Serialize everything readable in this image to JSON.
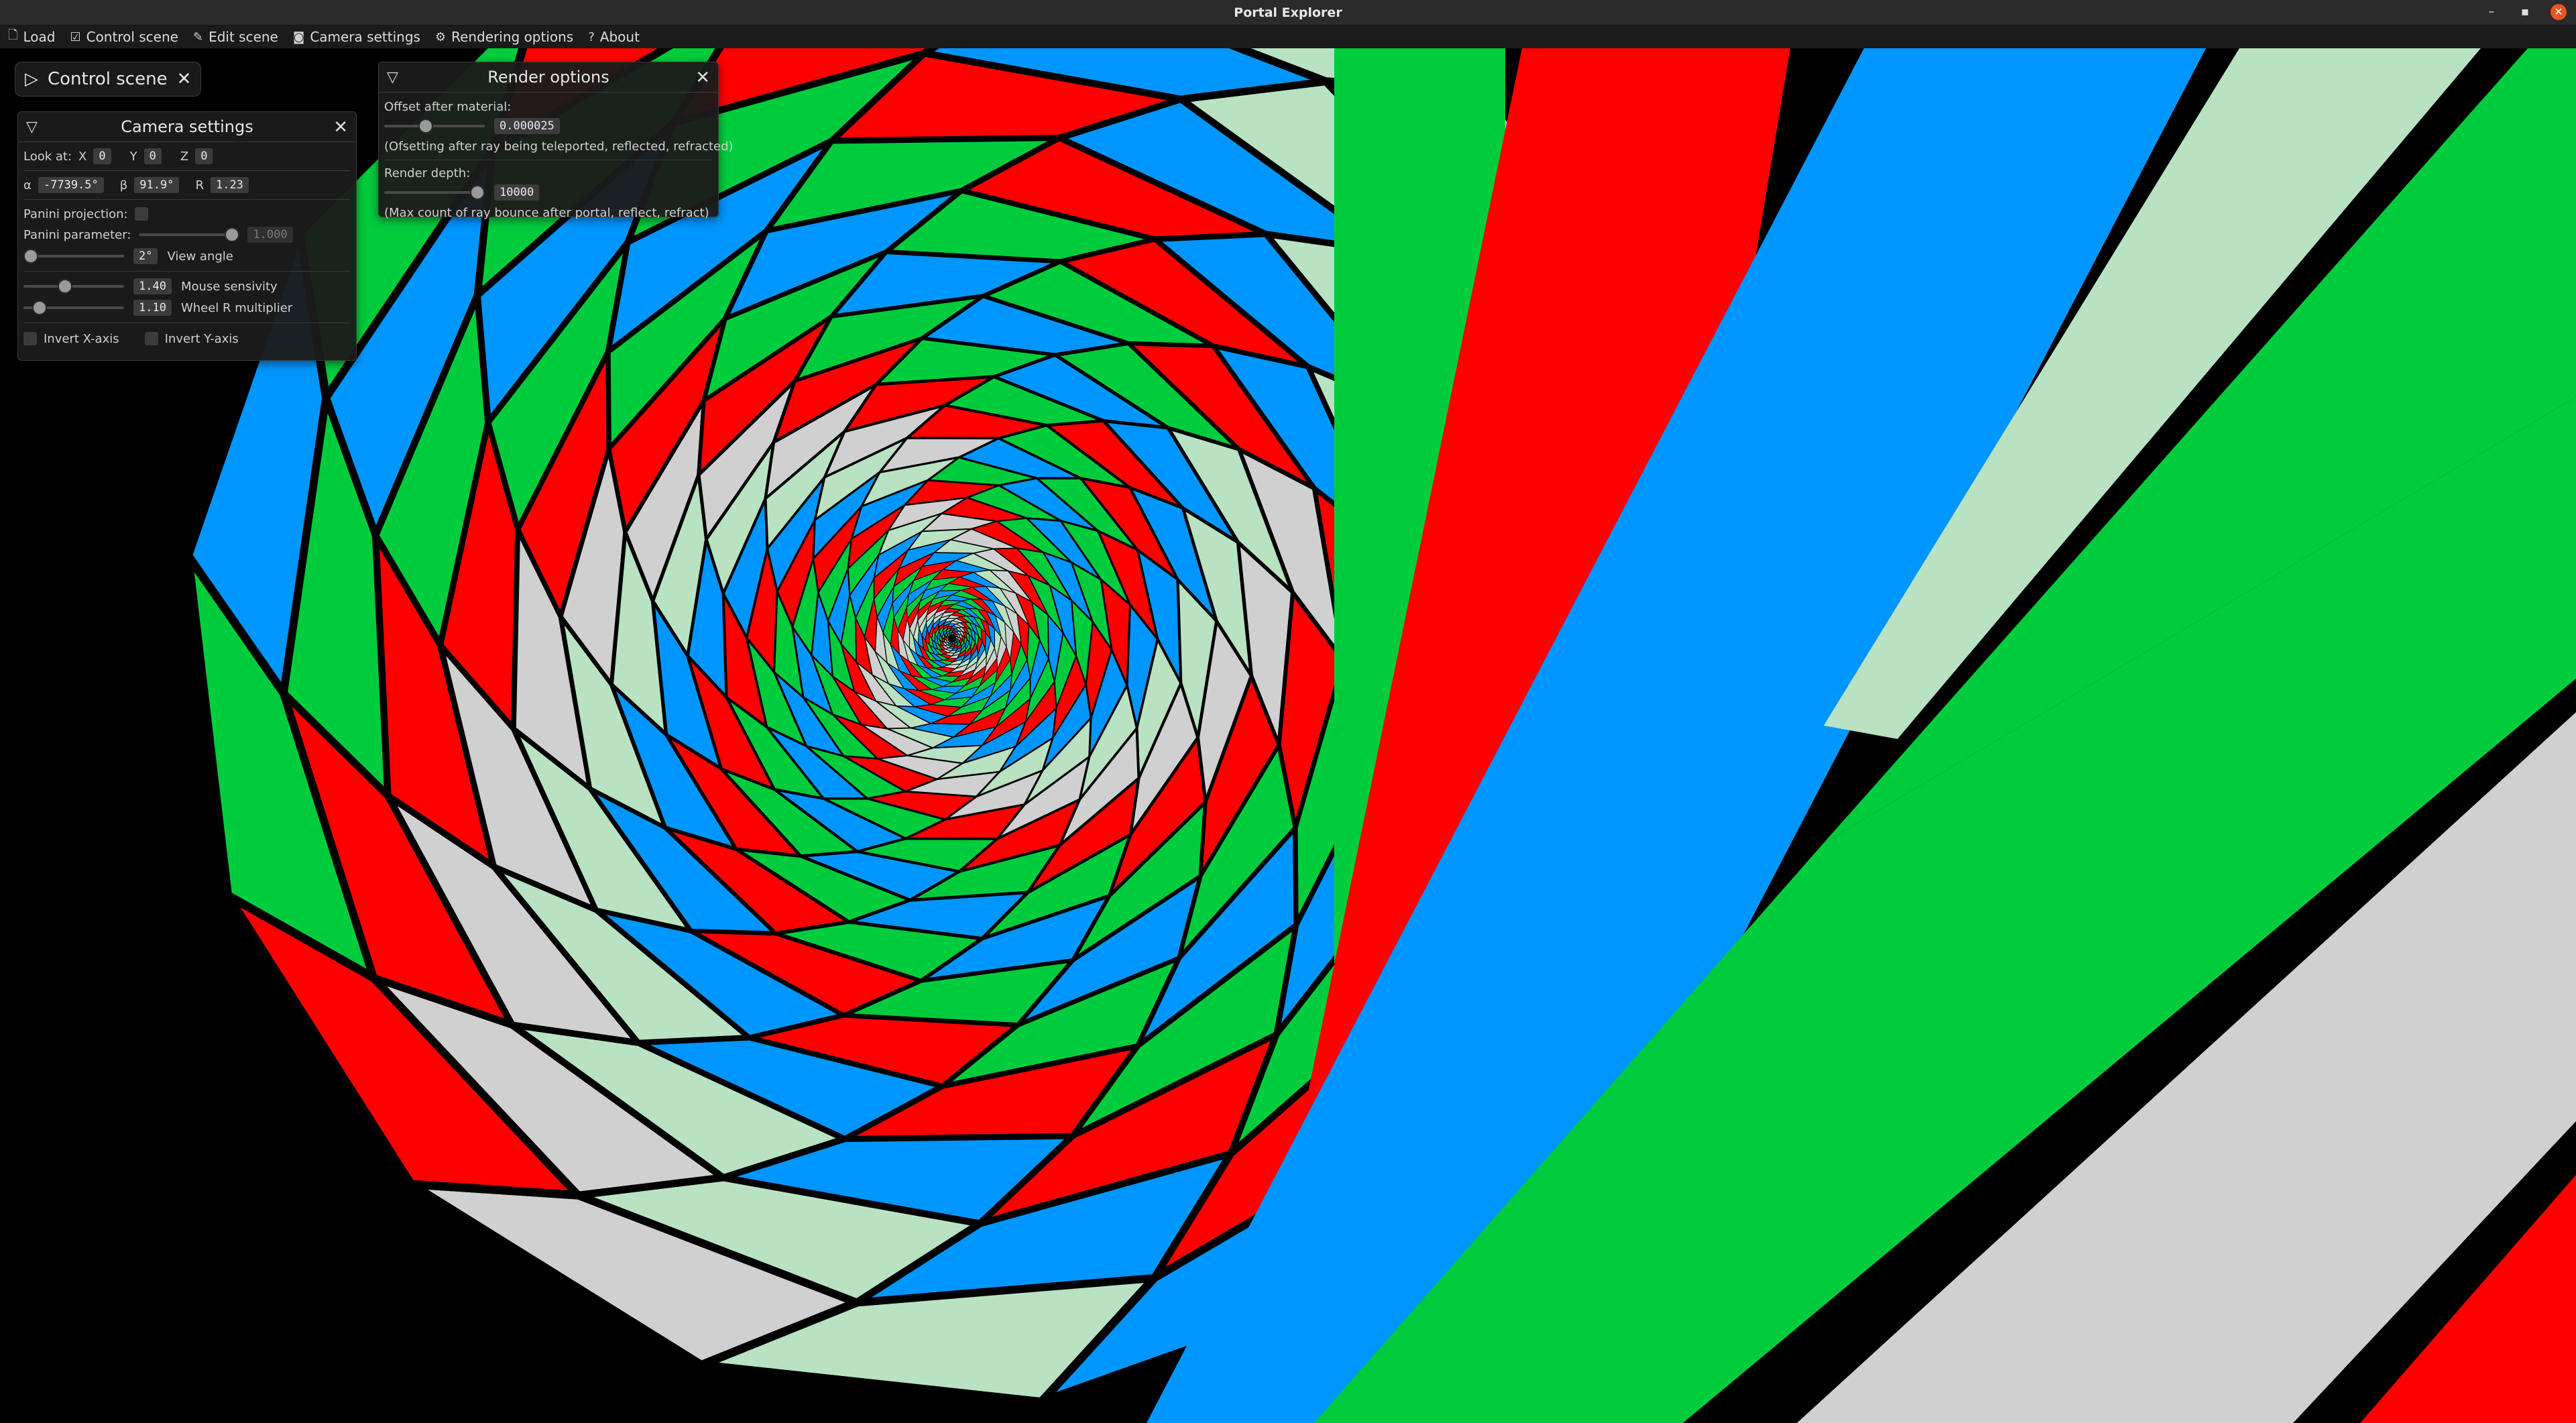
{
  "window": {
    "title": "Portal Explorer",
    "controls": [
      "minimize-icon",
      "maximize-icon",
      "close-icon"
    ]
  },
  "menu": [
    {
      "icon": "file-icon",
      "label": "Load"
    },
    {
      "icon": "checkbox-icon",
      "label": "Control scene"
    },
    {
      "icon": "pencil-icon",
      "label": "Edit scene"
    },
    {
      "icon": "camera-icon",
      "label": "Camera settings"
    },
    {
      "icon": "gear-icon",
      "label": "Rendering options"
    },
    {
      "icon": "question-icon",
      "label": "About"
    }
  ],
  "control_scene": {
    "title": "Control scene"
  },
  "camera": {
    "title": "Camera settings",
    "look_at_label": "Look at:",
    "x_label": "X",
    "x_value": "0",
    "y_label": "Y",
    "y_value": "0",
    "z_label": "Z",
    "z_value": "0",
    "alpha_label": "α",
    "alpha_value": "-7739.5°",
    "beta_label": "β",
    "beta_value": "91.9°",
    "r_label": "R",
    "r_value": "1.23",
    "panini_projection_label": "Panini projection:",
    "panini_projection_checked": false,
    "panini_parameter_label": "Panini parameter:",
    "panini_parameter_value": "1.000",
    "panini_parameter_level": 1.0,
    "view_angle_value": "2°",
    "view_angle_label": "View angle",
    "view_angle_level": 0.0,
    "mouse_sensivity_value": "1.40",
    "mouse_sensivity_label": "Mouse sensivity",
    "mouse_sensivity_level": 0.4,
    "wheel_value": "1.10",
    "wheel_label": "Wheel R multiplier",
    "wheel_level": 0.1,
    "invert_x_label": "Invert X-axis",
    "invert_y_label": "Invert Y-axis"
  },
  "render": {
    "title": "Render options",
    "offset_label": "Offset after material:",
    "offset_value": "0.000025",
    "offset_level": 0.4,
    "offset_note": "(Ofsetting after ray being teleported, reflected, refracted)",
    "depth_label": "Render depth:",
    "depth_value": "10000",
    "depth_level": 1.0,
    "depth_note": "(Max count of ray bounce after portal, reflect, refract)"
  }
}
